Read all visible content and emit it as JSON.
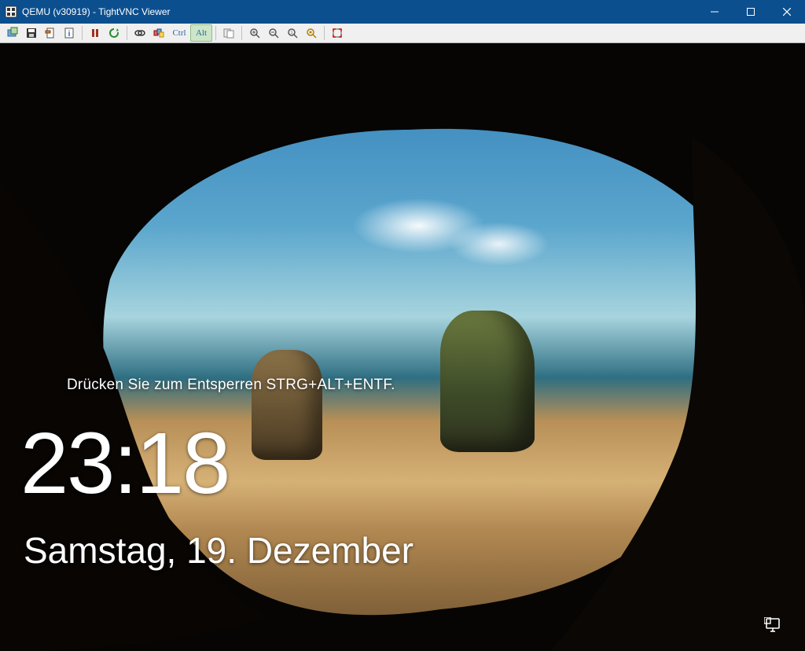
{
  "window": {
    "title": "QEMU (v30919) - TightVNC Viewer",
    "controls": {
      "minimize": "minimize",
      "maximize": "maximize",
      "close": "close"
    }
  },
  "toolbar": {
    "items": [
      {
        "name": "new-connection-icon"
      },
      {
        "name": "save-icon"
      },
      {
        "name": "options-icon"
      },
      {
        "name": "connection-info-icon"
      },
      {
        "sep": true
      },
      {
        "name": "pause-icon"
      },
      {
        "name": "refresh-icon"
      },
      {
        "sep": true
      },
      {
        "name": "send-cad-icon"
      },
      {
        "name": "send-ctrl-esc-icon"
      },
      {
        "name": "ctrl-key-button",
        "label": "Ctrl"
      },
      {
        "name": "alt-key-button",
        "label": "Alt",
        "pressed": true
      },
      {
        "sep": true
      },
      {
        "name": "file-transfer-icon"
      },
      {
        "sep": true
      },
      {
        "name": "zoom-in-icon"
      },
      {
        "name": "zoom-out-icon"
      },
      {
        "name": "zoom-100-icon"
      },
      {
        "name": "zoom-auto-icon"
      },
      {
        "sep": true
      },
      {
        "name": "fullscreen-icon"
      }
    ]
  },
  "lockscreen": {
    "unlock_hint": "Drücken Sie zum Entsperren STRG+ALT+ENTF.",
    "time": "23:18",
    "date": "Samstag, 19. Dezember"
  }
}
